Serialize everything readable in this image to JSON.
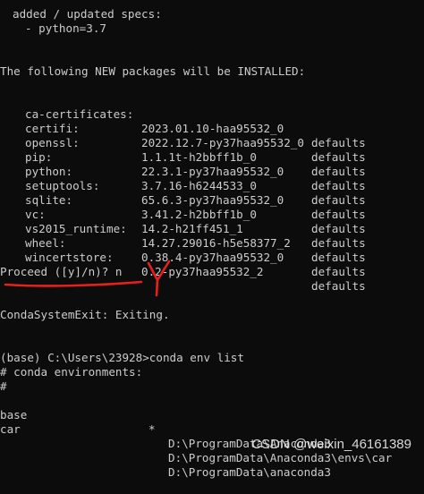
{
  "terminal": {
    "specs_header": "added / updated specs:",
    "specs_item": "- python=3.7",
    "new_packages_header": "The following NEW packages will be INSTALLED:",
    "packages": [
      {
        "name": "ca-certificates:",
        "version": "2023.01.10-haa95532_0",
        "channel": "defaults"
      },
      {
        "name": "certifi:",
        "version": "2022.12.7-py37haa95532_0",
        "channel": "defaults"
      },
      {
        "name": "openssl:",
        "version": "1.1.1t-h2bbff1b_0",
        "channel": "defaults"
      },
      {
        "name": "pip:",
        "version": "22.3.1-py37haa95532_0",
        "channel": "defaults"
      },
      {
        "name": "python:",
        "version": "3.7.16-h6244533_0",
        "channel": "defaults"
      },
      {
        "name": "setuptools:",
        "version": "65.6.3-py37haa95532_0",
        "channel": "defaults"
      },
      {
        "name": "sqlite:",
        "version": "3.41.2-h2bbff1b_0",
        "channel": "defaults"
      },
      {
        "name": "vc:",
        "version": "14.2-h21ff451_1",
        "channel": "defaults"
      },
      {
        "name": "vs2015_runtime:",
        "version": "14.27.29016-h5e58377_2",
        "channel": "defaults"
      },
      {
        "name": "wheel:",
        "version": "0.38.4-py37haa95532_0",
        "channel": "defaults"
      },
      {
        "name": "wincertstore:",
        "version": "0.2-py37haa95532_2",
        "channel": "defaults"
      }
    ],
    "proceed_prompt": "Proceed ([y]/n)? n",
    "exit_message": "CondaSystemExit: Exiting.",
    "command_line": "(base) C:\\Users\\23928>conda env list",
    "env_header": "# conda environments:",
    "env_hash": "#",
    "environments": [
      {
        "name": "base",
        "star": "*",
        "path": "D:\\ProgramData\\Anaconda3"
      },
      {
        "name": "car",
        "star": "",
        "path": "D:\\ProgramData\\Anaconda3\\envs\\car"
      },
      {
        "name": "",
        "star": "",
        "path": "D:\\ProgramData\\anaconda3"
      }
    ]
  },
  "annotation": {
    "handwritten_letter": "Y",
    "color": "#e8201c"
  },
  "watermark": "CSDN @weixin_46161389"
}
